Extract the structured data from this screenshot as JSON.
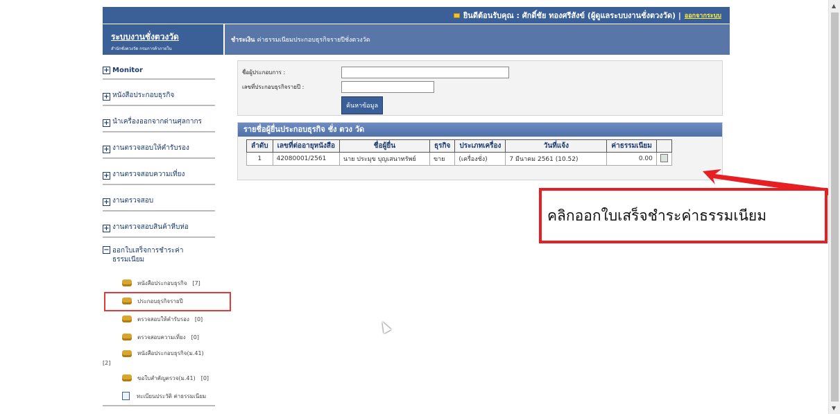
{
  "topbar": {
    "welcome": "ยินดีต้อนรับคุณ : ศักดิ์ชัย ทองศรีสังข์ (ผู้ดูแลระบบงานชั่งตวงวัด) |",
    "logout": "ออกจากระบบ"
  },
  "brand": {
    "title": "ระบบงานชั่งตวงวัด",
    "subtitle": "สำนักชั่งตวงวัด กรมการค้าภายใน"
  },
  "page_header": {
    "section": "ชำระเงิน",
    "title": "ค่าธรรมเนียมประกอบธุรกิจรายปีชั่งตวงวัด"
  },
  "sidebar": {
    "items": [
      {
        "label": "Monitor"
      },
      {
        "label": "หนังสือประกอบธุรกิจ"
      },
      {
        "label": "นำเครื่องออกจากด่านศุลกากร"
      },
      {
        "label": "งานตรวจสอบให้คำรับรอง"
      },
      {
        "label": "งานตรวจสอบความเที่ยง"
      },
      {
        "label": "งานตรวจสอบ"
      },
      {
        "label": "งานตรวจสอบสินค้าหีบห่อ"
      }
    ],
    "open_group": {
      "label": "ออกใบเสร็จการชำระค่าธรรมเนียม",
      "subs": [
        {
          "label": "หนังสือประกอบธุรกิจ",
          "count": "[7]"
        },
        {
          "label": "ประกอบธุรกิจรายปี",
          "count": ""
        },
        {
          "label": "ตรวจสอบให้คำรับรอง",
          "count": "[0]"
        },
        {
          "label": "ตรวจสอบความเที่ยง",
          "count": "[0]"
        },
        {
          "label": "หนังสือประกอบธุรกิจ(ม.41)",
          "count": "[2]"
        },
        {
          "label": "ขอใบสำคัญตรวจ(ม.41)",
          "count": "[0]"
        },
        {
          "label": "ทะเบียนประวัติ ค่าธรรมเนียม",
          "count": ""
        }
      ]
    }
  },
  "search": {
    "name_label": "ชื่อผู้ประกอบการ :",
    "name_value": "",
    "license_label": "เลขที่ประกอบธุรกิจรายปี :",
    "license_value": "",
    "button": "ค้นหาข้อมูล"
  },
  "list": {
    "title": "รายชื่อผู้ยื่นประกอบธุรกิจ ชั่ง ตวง วัด",
    "columns": [
      "ลำดับ",
      "เลขที่ต่ออายุหนังสือ",
      "ชื่อผู้ยื่น",
      "ธุรกิจ",
      "ประเภทเครื่อง",
      "วันที่แจ้ง",
      "ค่าธรรมเนียม"
    ],
    "rows": [
      [
        "1",
        "42080001/2561",
        "นาย ประมุข บุญเสนาทรัพย์",
        "ขาย",
        "(เครื่องชั่ง)",
        "7 มีนาคม 2561 (10.52)",
        "0.00"
      ]
    ]
  },
  "callout": {
    "text": "คลิกออกใบเสร็จชำระค่าธรรมเนียม"
  },
  "colors": {
    "header_blue": "#3b5f97",
    "highlight_red": "#e61f23"
  }
}
